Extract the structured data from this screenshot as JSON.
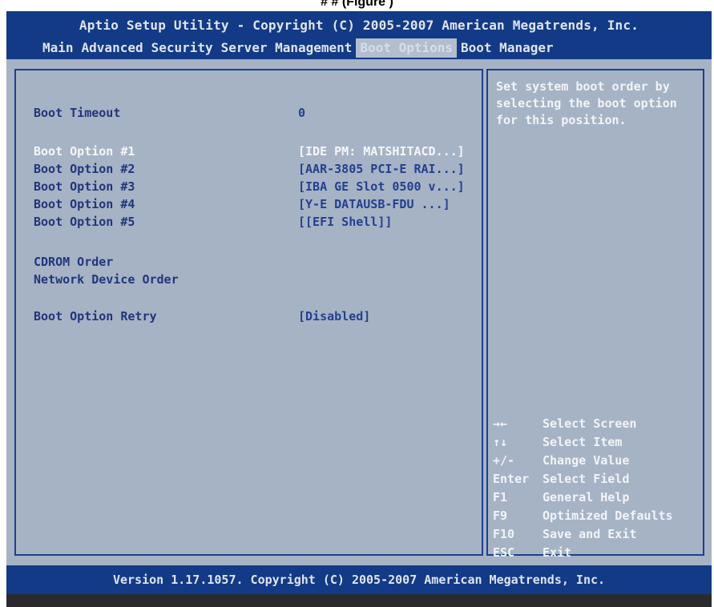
{
  "caption": "#   #  (Figure  )",
  "header": {
    "title": "Aptio Setup Utility - Copyright (C) 2005-2007 American Megatrends, Inc.",
    "menu": [
      {
        "label": "Main",
        "active": false
      },
      {
        "label": "Advanced",
        "active": false
      },
      {
        "label": "Security",
        "active": false
      },
      {
        "label": "Server Management",
        "active": false
      },
      {
        "label": "Boot Options",
        "active": true
      },
      {
        "label": "Boot Manager",
        "active": false
      }
    ]
  },
  "settings": {
    "boot_timeout": {
      "label": "Boot Timeout",
      "value": "0"
    },
    "boot_option_1": {
      "label": "Boot Option #1",
      "value": "[IDE PM: MATSHITACD...]"
    },
    "boot_option_2": {
      "label": "Boot Option #2",
      "value": "[AAR-3805 PCI-E RAI...]"
    },
    "boot_option_3": {
      "label": "Boot Option #3",
      "value": "[IBA GE Slot 0500 v...]"
    },
    "boot_option_4": {
      "label": "Boot Option #4",
      "value": "[Y-E DATAUSB-FDU    ...]"
    },
    "boot_option_5": {
      "label": "Boot Option #5",
      "value": "[[EFI Shell]]"
    },
    "cdrom_order": {
      "label": "CDROM Order"
    },
    "network_device_order": {
      "label": "Network Device Order"
    },
    "boot_option_retry": {
      "label": "Boot Option Retry",
      "value": "[Disabled]"
    }
  },
  "help": {
    "text": "Set system boot order by selecting the boot option for this position."
  },
  "keys": [
    {
      "key": "→←",
      "desc": "Select Screen"
    },
    {
      "key": "↑↓",
      "desc": "Select Item"
    },
    {
      "key": "+/-",
      "desc": "Change Value"
    },
    {
      "key": "Enter",
      "desc": "Select Field"
    },
    {
      "key": "F1",
      "desc": "General Help"
    },
    {
      "key": "F9",
      "desc": "Optimized Defaults"
    },
    {
      "key": "F10",
      "desc": "Save and Exit"
    },
    {
      "key": "ESC",
      "desc": "Exit"
    }
  ],
  "footer": {
    "text": "Version 1.17.1057. Copyright (C) 2005-2007 American Megatrends, Inc."
  },
  "colors": {
    "header_bg": "#123a86",
    "panel_bg": "#a6b3c5",
    "highlight_text": "#f4f6fa",
    "normal_text": "#22357c"
  }
}
